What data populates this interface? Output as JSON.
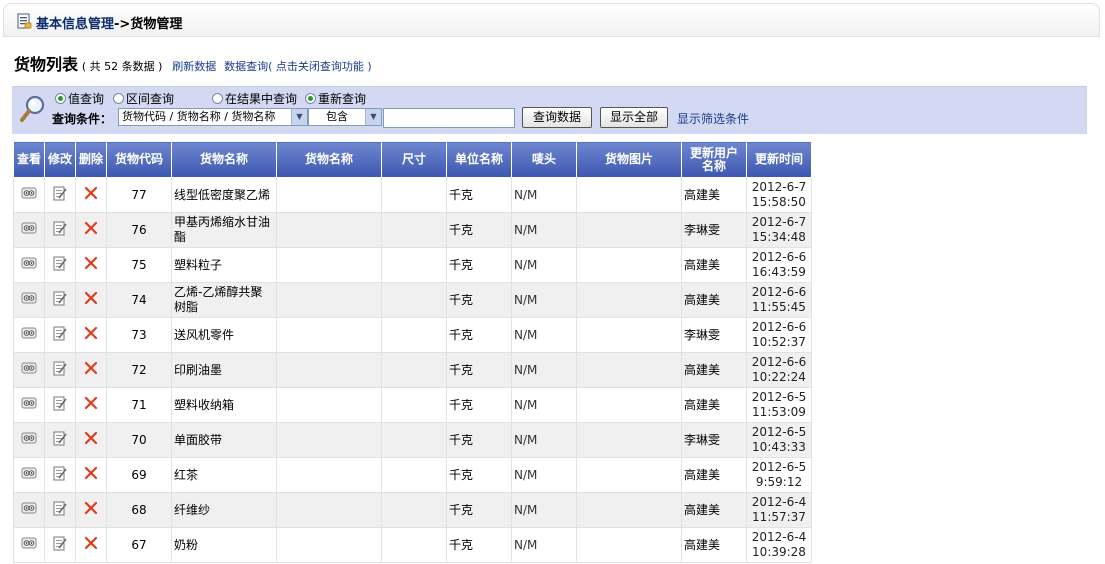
{
  "breadcrumb": {
    "parent": "基本信息管理",
    "separator": "->",
    "current": "货物管理"
  },
  "list_header": {
    "title": "货物列表",
    "count_text": "( 共 52 条数据 )",
    "refresh_link": "刷新数据",
    "query_link": "数据查询",
    "toggle_link": "( 点击关闭查询功能 )"
  },
  "search": {
    "radios": [
      {
        "label": "值查询",
        "checked": true
      },
      {
        "label": "区间查询",
        "checked": false
      },
      {
        "label": "在结果中查询",
        "checked": false
      },
      {
        "label": "重新查询",
        "checked": true
      }
    ],
    "condition_label": "查询条件：",
    "field_select": "货物代码 / 货物名称 / 货物名称",
    "operator_select": "包含",
    "value_input": "",
    "query_button": "查询数据",
    "show_all_button": "显示全部",
    "filter_link": "显示筛选条件"
  },
  "table": {
    "headers": [
      "查看",
      "修改",
      "删除",
      "货物代码",
      "货物名称",
      "货物名称",
      "尺寸",
      "单位名称",
      "唛头",
      "货物图片",
      "更新用户名称",
      "更新时间"
    ],
    "rows": [
      {
        "code": "77",
        "name": "线型低密度聚乙烯",
        "name2": "",
        "size": "",
        "unit": "千克",
        "mark": "N/M",
        "image": "",
        "user": "高建美",
        "date": "2012-6-7",
        "time": "15:58:50"
      },
      {
        "code": "76",
        "name": "甲基丙烯缩水甘油酯",
        "name2": "",
        "size": "",
        "unit": "千克",
        "mark": "N/M",
        "image": "",
        "user": "李琳雯",
        "date": "2012-6-7",
        "time": "15:34:48"
      },
      {
        "code": "75",
        "name": "塑料粒子",
        "name2": "",
        "size": "",
        "unit": "千克",
        "mark": "N/M",
        "image": "",
        "user": "高建美",
        "date": "2012-6-6",
        "time": "16:43:59"
      },
      {
        "code": "74",
        "name": "乙烯-乙烯醇共聚树脂",
        "name2": "",
        "size": "",
        "unit": "千克",
        "mark": "N/M",
        "image": "",
        "user": "高建美",
        "date": "2012-6-6",
        "time": "11:55:45"
      },
      {
        "code": "73",
        "name": "送风机零件",
        "name2": "",
        "size": "",
        "unit": "千克",
        "mark": "N/M",
        "image": "",
        "user": "李琳雯",
        "date": "2012-6-6",
        "time": "10:52:37"
      },
      {
        "code": "72",
        "name": "印刷油墨",
        "name2": "",
        "size": "",
        "unit": "千克",
        "mark": "N/M",
        "image": "",
        "user": "高建美",
        "date": "2012-6-6",
        "time": "10:22:24"
      },
      {
        "code": "71",
        "name": "塑料收纳箱",
        "name2": "",
        "size": "",
        "unit": "千克",
        "mark": "N/M",
        "image": "",
        "user": "高建美",
        "date": "2012-6-5",
        "time": "11:53:09"
      },
      {
        "code": "70",
        "name": "单面胶带",
        "name2": "",
        "size": "",
        "unit": "千克",
        "mark": "N/M",
        "image": "",
        "user": "李琳雯",
        "date": "2012-6-5",
        "time": "10:43:33"
      },
      {
        "code": "69",
        "name": "红茶",
        "name2": "",
        "size": "",
        "unit": "千克",
        "mark": "N/M",
        "image": "",
        "user": "高建美",
        "date": "2012-6-5",
        "time": "9:59:12"
      },
      {
        "code": "68",
        "name": "纤维纱",
        "name2": "",
        "size": "",
        "unit": "千克",
        "mark": "N/M",
        "image": "",
        "user": "高建美",
        "date": "2012-6-4",
        "time": "11:57:37"
      },
      {
        "code": "67",
        "name": "奶粉",
        "name2": "",
        "size": "",
        "unit": "千克",
        "mark": "N/M",
        "image": "",
        "user": "高建美",
        "date": "2012-6-4",
        "time": "10:39:28"
      }
    ]
  },
  "icons": {
    "view": "view-icon",
    "edit": "edit-icon",
    "delete": "delete-icon",
    "header_doc": "document-icon",
    "search": "magnifier-icon"
  },
  "colors": {
    "header_bg": "#4a64bb",
    "panel_bg": "#d3d9f2",
    "delete": "#e03c1c",
    "link": "#1a3c8c"
  }
}
